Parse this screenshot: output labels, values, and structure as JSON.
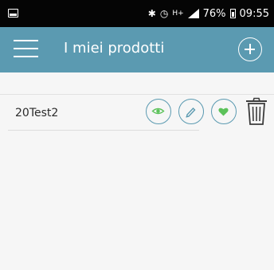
{
  "status_bar": {
    "battery": "76%",
    "time": "09:55",
    "icons": [
      "screenshot-icon",
      "bluetooth-icon",
      "alarm-icon",
      "hplus-icon",
      "signal-icon",
      "battery-icon"
    ]
  },
  "app_bar": {
    "title": "I miei prodotti",
    "color": "#5b9ab1",
    "icons": [
      "menu-icon",
      "add-icon"
    ]
  },
  "products": [
    {
      "name": "20Test2",
      "actions": [
        "view-icon",
        "edit-icon",
        "favorite-icon",
        "delete-icon"
      ]
    }
  ],
  "colors": {
    "accent": "#5b9ab1",
    "action_green": "#5cc25a",
    "background": "#f6f6f6"
  }
}
